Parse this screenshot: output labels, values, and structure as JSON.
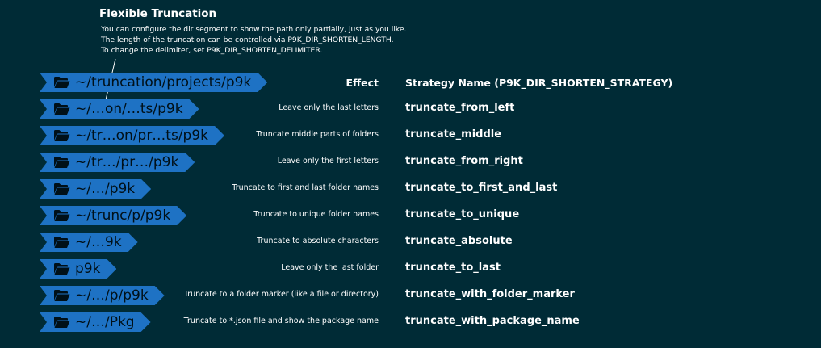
{
  "title": "Flexible Truncation",
  "description": [
    "You can configure the dir segment to show the path only partially, just as you like.",
    "The length of the truncation can be controlled via P9K_DIR_SHORTEN_LENGTH.",
    "To change the delimiter, set P9K_DIR_SHORTEN_DELIMITER."
  ],
  "header": {
    "effect": "Effect",
    "strategy": "Strategy Name (P9K_DIR_SHORTEN_STRATEGY)"
  },
  "colors": {
    "background": "#002b36",
    "segment": "#1e72c4",
    "segment_text": "#001018",
    "text": "#ffffff"
  },
  "rows": [
    {
      "path": "~/truncation/projects/p9k",
      "effect": "",
      "strategy": ""
    },
    {
      "path": "~/…on/…ts/p9k",
      "effect": "Leave only the last letters",
      "strategy": "truncate_from_left"
    },
    {
      "path": "~/tr…on/pr…ts/p9k",
      "effect": "Truncate middle parts of folders",
      "strategy": "truncate_middle"
    },
    {
      "path": "~/tr…/pr…/p9k",
      "effect": "Leave only the first letters",
      "strategy": "truncate_from_right"
    },
    {
      "path": "~/…/p9k",
      "effect": "Truncate to first and last folder names",
      "strategy": "truncate_to_first_and_last"
    },
    {
      "path": "~/trunc/p/p9k",
      "effect": "Truncate to unique folder names",
      "strategy": "truncate_to_unique"
    },
    {
      "path": "~/…9k",
      "effect": "Truncate to absolute characters",
      "strategy": "truncate_absolute"
    },
    {
      "path": "p9k",
      "effect": "Leave only the last folder",
      "strategy": "truncate_to_last"
    },
    {
      "path": "~/…/p/p9k",
      "effect": "Truncate to a folder marker (like a file or directory)",
      "strategy": "truncate_with_folder_marker"
    },
    {
      "path": "~/…/Pkg",
      "effect": "Truncate to *.json file and show the package name",
      "strategy": "truncate_with_package_name"
    }
  ]
}
